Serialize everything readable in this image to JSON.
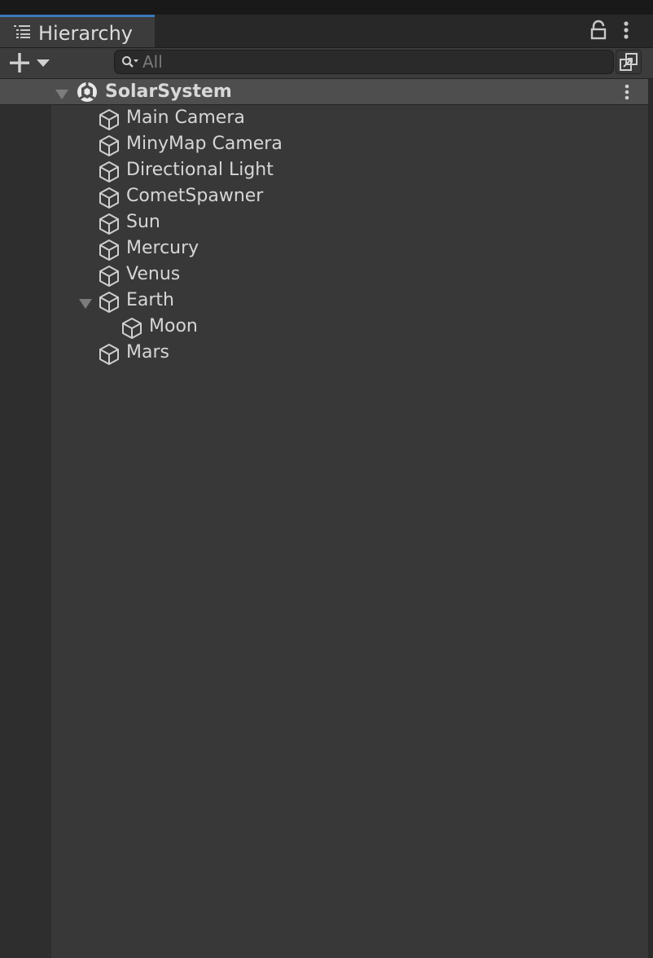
{
  "window": {
    "tab_title": "Hierarchy",
    "tab_icon": "hierarchy-list-icon",
    "lock_icon": "lock-icon",
    "menu_icon": "kebab-menu-icon",
    "accent_color": "#3a79bb"
  },
  "toolbar": {
    "add_icon": "plus-icon",
    "add_dropdown_icon": "caret-down-icon",
    "search_icon": "search-icon",
    "search_placeholder": "All",
    "search_value": "",
    "scene_view_icon": "scene-view-search-icon"
  },
  "scene": {
    "name": "SolarSystem",
    "icon": "unity-logo-icon",
    "expanded": true,
    "menu_icon": "kebab-menu-icon",
    "objects": [
      {
        "name": "Main Camera",
        "icon": "cube-icon",
        "depth": 1
      },
      {
        "name": "MinyMap Camera",
        "icon": "cube-icon",
        "depth": 1
      },
      {
        "name": "Directional Light",
        "icon": "cube-icon",
        "depth": 1
      },
      {
        "name": "CometSpawner",
        "icon": "cube-icon",
        "depth": 1
      },
      {
        "name": "Sun",
        "icon": "cube-icon",
        "depth": 1
      },
      {
        "name": "Mercury",
        "icon": "cube-icon",
        "depth": 1
      },
      {
        "name": "Venus",
        "icon": "cube-icon",
        "depth": 1
      },
      {
        "name": "Earth",
        "icon": "cube-icon",
        "depth": 1,
        "expanded": true
      },
      {
        "name": "Moon",
        "icon": "cube-icon",
        "depth": 2
      },
      {
        "name": "Mars",
        "icon": "cube-icon",
        "depth": 1
      }
    ]
  }
}
